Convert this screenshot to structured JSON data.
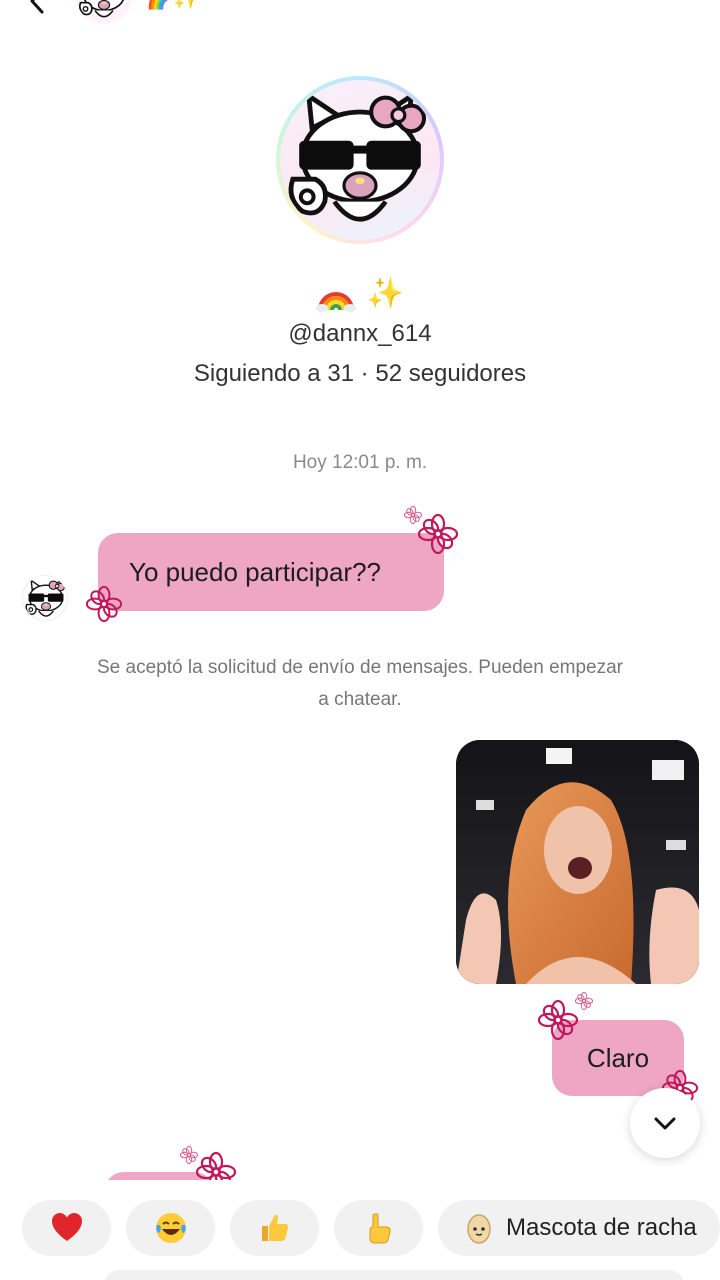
{
  "header": {
    "back_icon": "chevron-left-icon",
    "avatar_icon": "hello-kitty-sunglasses-avatar",
    "emoji": "🌈✨"
  },
  "profile": {
    "avatar_icon": "hello-kitty-sunglasses-avatar",
    "bio_emoji_1": "🌈",
    "bio_emoji_2": "✨",
    "username": "@dannx_614",
    "stats": "Siguiendo a 31 · 52 seguidores"
  },
  "chat": {
    "timestamp": "Hoy 12:01 p. m.",
    "messages": [
      {
        "direction": "incoming",
        "text": "Yo puedo participar??"
      },
      {
        "direction": "system",
        "text": "Se aceptó la solicitud de envío de mensajes. Pueden empezar a chatear."
      },
      {
        "direction": "outgoing",
        "type": "image",
        "icon": "photo-thumbnail"
      },
      {
        "direction": "outgoing",
        "text": "Claro"
      }
    ]
  },
  "scroll_button": {
    "icon": "chevron-down-icon"
  },
  "quick_reactions": [
    {
      "icon": "red-heart-icon",
      "glyph": "❤️"
    },
    {
      "icon": "tears-of-joy-icon",
      "glyph": "😂"
    },
    {
      "icon": "thumbs-up-icon",
      "glyph": "👍"
    },
    {
      "icon": "pointing-hand-icon",
      "glyph": "👆"
    },
    {
      "icon": "egg-pet-icon",
      "label": "Mascota de racha"
    }
  ],
  "colors": {
    "bubble": "#eea6c4",
    "flower": "#c2185b",
    "chip_bg": "#f1f1f1",
    "muted_text": "#8a8a8a"
  }
}
